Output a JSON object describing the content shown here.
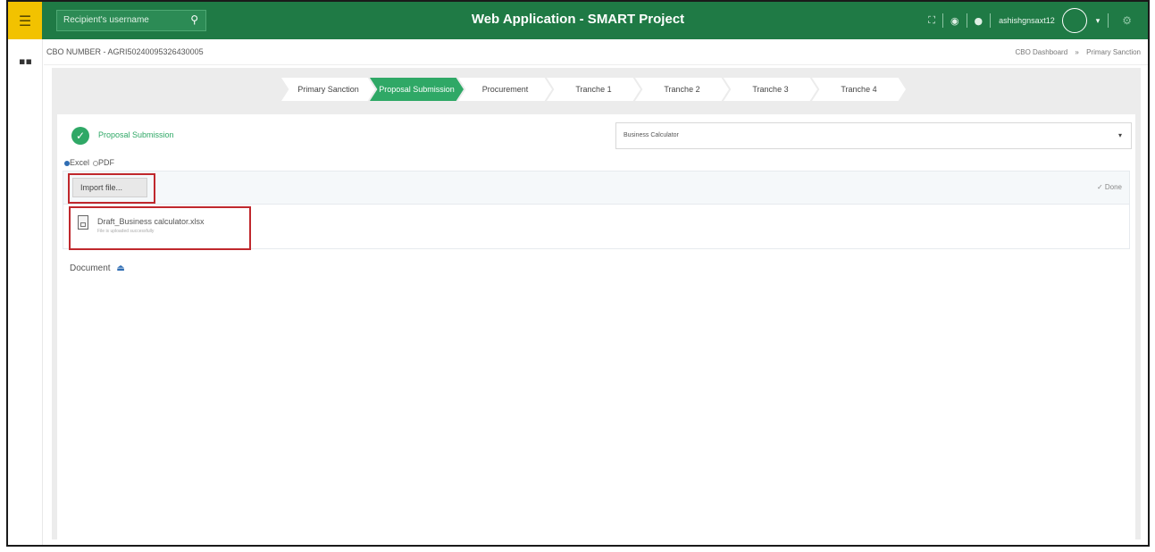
{
  "header": {
    "search_placeholder": "Recipient's username",
    "title": "Web Application - SMART Project",
    "username": "ashishgnsaxt12",
    "icons": [
      "menu-icon",
      "search-icon",
      "fullscreen-icon",
      "globe-icon",
      "bell-icon",
      "avatar",
      "chevron-down-icon",
      "gear-icon"
    ],
    "accent_color": "#1f7a45",
    "menu_color": "#f2c200"
  },
  "breadcrumb_bar": {
    "cbo_number": "CBO NUMBER - AGRI50240095326430005",
    "crumbs": [
      "CBO Dashboard",
      "Primary Sanction"
    ],
    "separator": "»"
  },
  "stepper": {
    "steps": [
      "Primary Sanction",
      "Proposal Submission",
      "Procurement",
      "Tranche 1",
      "Tranche 2",
      "Tranche 3",
      "Tranche 4"
    ],
    "active_index": 1,
    "active_color": "#2fa866"
  },
  "section": {
    "title": "Proposal Submission",
    "select_value": "Business Calculator",
    "format_options": [
      "Excel",
      "PDF"
    ],
    "selected_format": "Excel"
  },
  "upload": {
    "import_label": "Import file...",
    "done_label": "✓ Done",
    "file_name": "Draft_Business calculator.xlsx",
    "file_status": "File is uploaded successfully"
  },
  "document": {
    "label": "Document"
  }
}
